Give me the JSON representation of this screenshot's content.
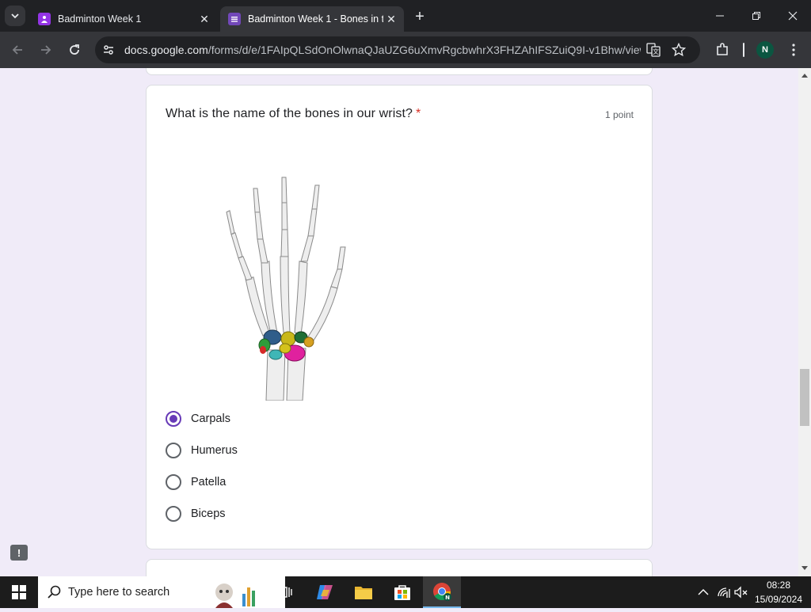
{
  "browser": {
    "tabs": [
      {
        "title": "Badminton Week 1",
        "active": false
      },
      {
        "title": "Badminton Week 1 - Bones in th",
        "active": true
      }
    ],
    "url_host": "docs.google.com",
    "url_path": "/forms/d/e/1FAIpQLSdOnOlwnaQJaUZG6uXmvRgcbwhrX3FHZAhIFSZuiQ9I-v1Bhw/view...",
    "profile_initial": "N"
  },
  "form": {
    "question": "What is the name of the bones in our wrist?",
    "required_mark": "*",
    "points": "1 point",
    "options": [
      {
        "label": "Carpals",
        "selected": true
      },
      {
        "label": "Humerus",
        "selected": false
      },
      {
        "label": "Patella",
        "selected": false
      },
      {
        "label": "Biceps",
        "selected": false
      }
    ],
    "feedback_symbol": "!"
  },
  "taskbar": {
    "search_placeholder": "Type here to search",
    "time": "08:28",
    "date": "15/09/2024"
  },
  "colors": {
    "accent": "#673ab7",
    "page_bg": "#f0ebf8",
    "required": "#d93025"
  }
}
